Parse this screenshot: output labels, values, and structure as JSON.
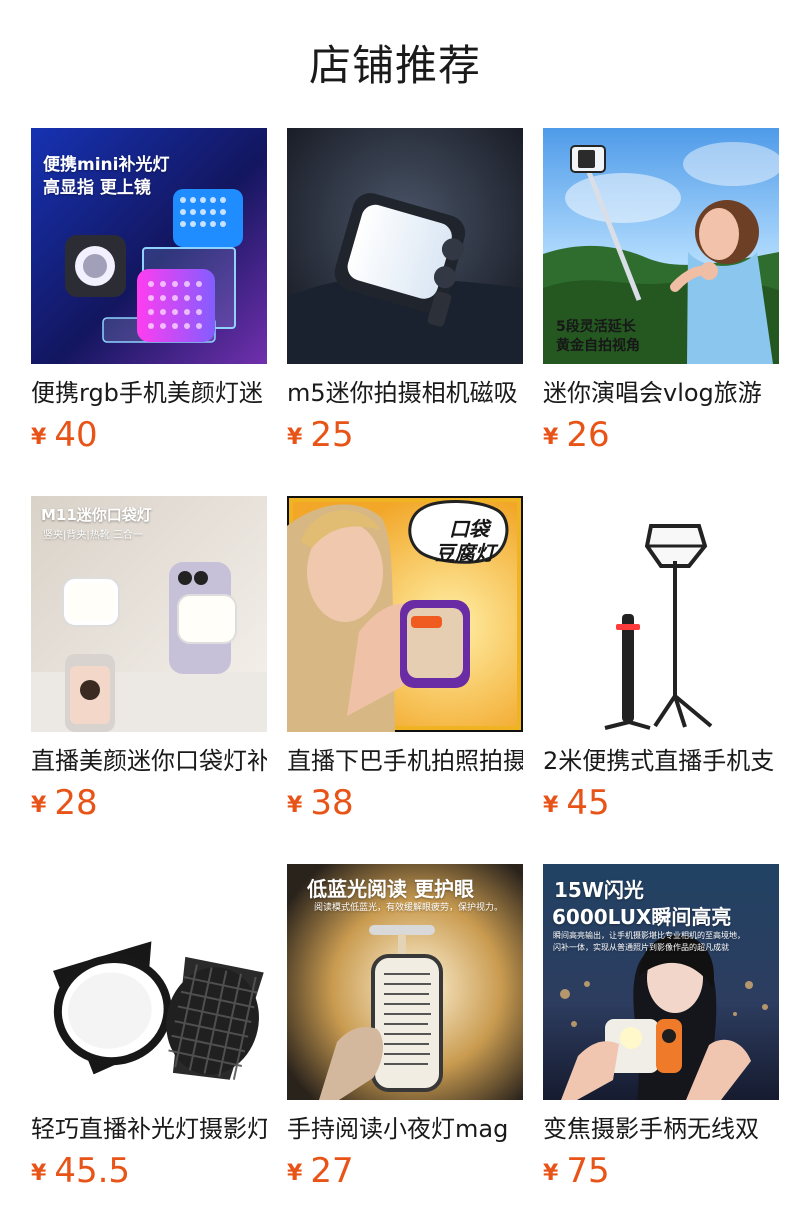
{
  "page": {
    "title": "店铺推荐"
  },
  "products": [
    {
      "name": "便携rgb手机美颜灯迷",
      "currency": "¥",
      "price": "40",
      "image_text": [
        "便携mini补光灯",
        "高显指 更上镜"
      ]
    },
    {
      "name": "m5迷你拍摄相机磁吸",
      "currency": "¥",
      "price": "25",
      "image_text": []
    },
    {
      "name": "迷你演唱会vlog旅游",
      "currency": "¥",
      "price": "26",
      "image_text": [
        "5段灵活延长",
        "黄金自拍视角"
      ]
    },
    {
      "name": "直播美颜迷你口袋灯补",
      "currency": "¥",
      "price": "28",
      "image_text": [
        "M11迷你口袋灯",
        "竖夹|背夹|热靴 三合一"
      ]
    },
    {
      "name": "直播下巴手机拍照拍摄",
      "currency": "¥",
      "price": "38",
      "image_text": [
        "口袋",
        "豆腐灯"
      ]
    },
    {
      "name": "2米便携式直播手机支",
      "currency": "¥",
      "price": "45",
      "image_text": []
    },
    {
      "name": "轻巧直播补光灯摄影灯",
      "currency": "¥",
      "price": "45.5",
      "image_text": []
    },
    {
      "name": "手持阅读小夜灯mag",
      "currency": "¥",
      "price": "27",
      "image_text": [
        "低蓝光阅读 更护眼",
        "阅读模式低蓝光，有效缓解眼疲劳，保护视力。"
      ]
    },
    {
      "name": "变焦摄影手柄无线双",
      "currency": "¥",
      "price": "75",
      "image_text": [
        "15W闪光",
        "6000LUX瞬间高亮",
        "瞬间高亮输出，让手机摄影堪比专业相机的至高境地，",
        "闪补一体，实现从普通照片到影像作品的超凡成就"
      ]
    }
  ]
}
